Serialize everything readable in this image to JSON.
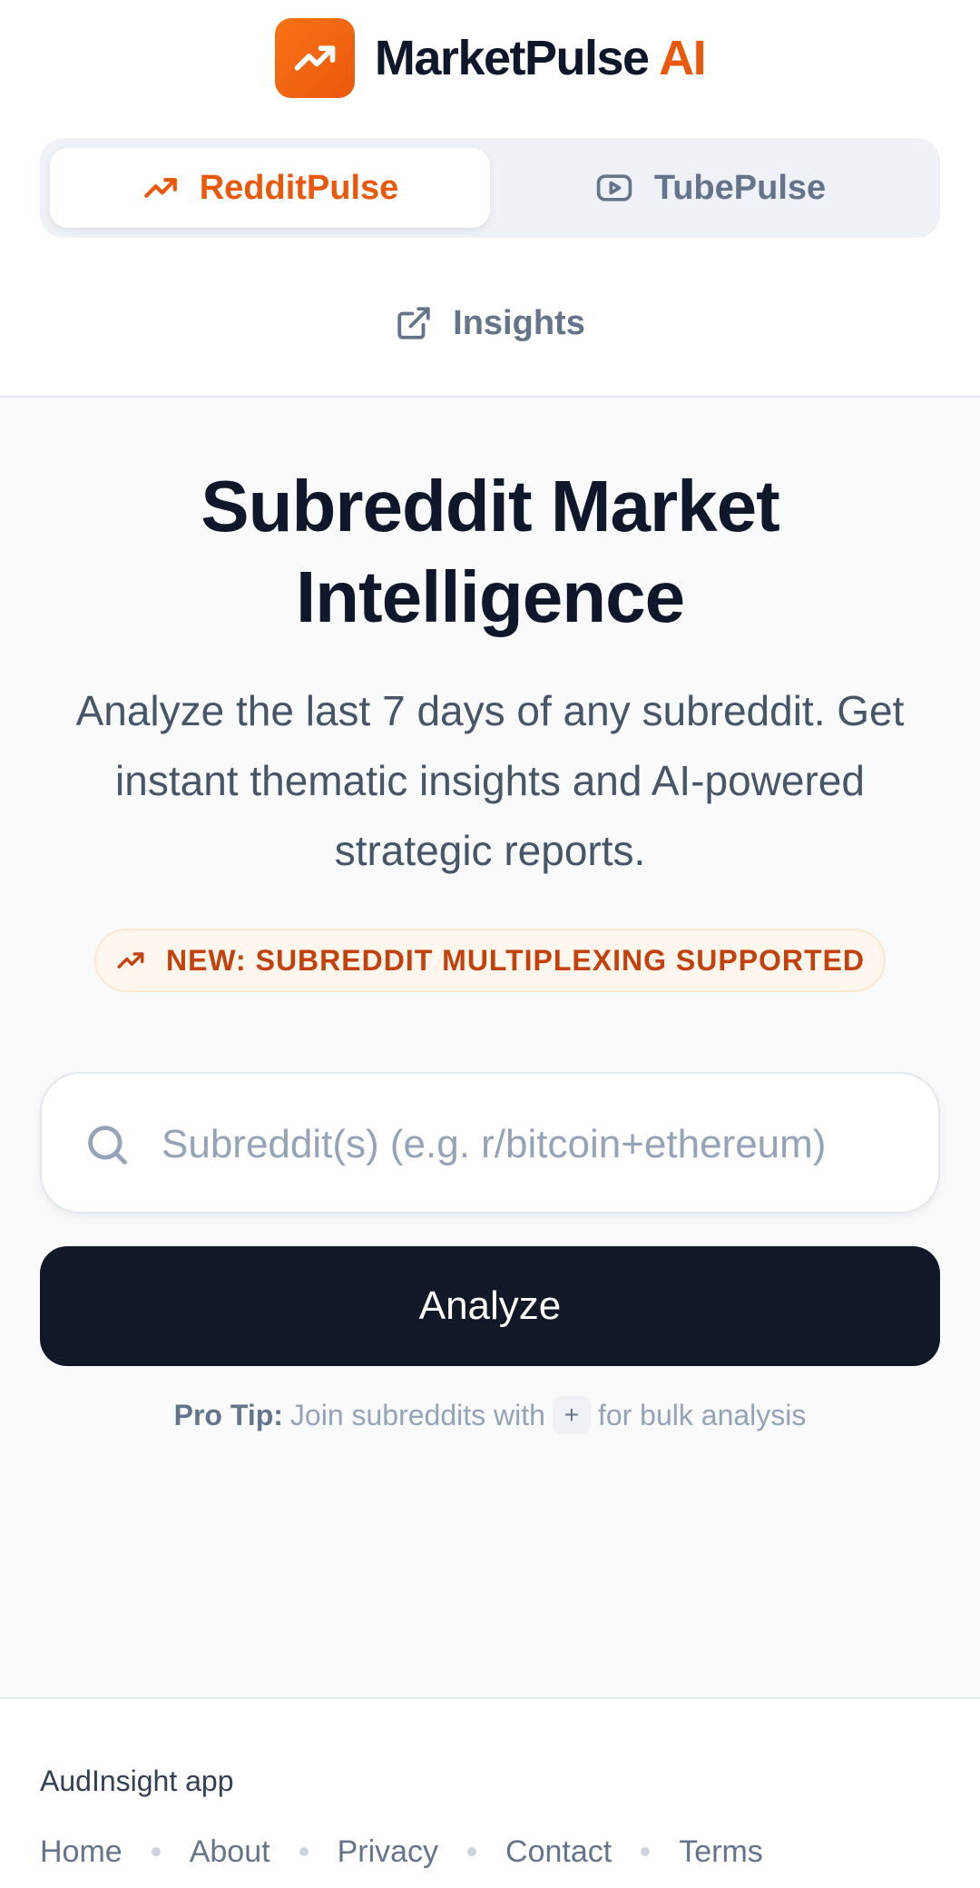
{
  "brand": {
    "name_main": "MarketPulse",
    "name_accent": "AI",
    "logo_icon": "trending-up-icon",
    "accent_color": "#ea580c"
  },
  "switcher": {
    "tabs": [
      {
        "label": "RedditPulse",
        "icon": "trending-up-icon",
        "active": true
      },
      {
        "label": "TubePulse",
        "icon": "youtube-play-icon",
        "active": false
      }
    ]
  },
  "insights_link": {
    "label": "Insights",
    "icon": "external-link-icon"
  },
  "main": {
    "title": "Subreddit Market Intelligence",
    "subtitle": "Analyze the last 7 days of any subreddit. Get instant thematic insights and AI-powered strategic reports.",
    "badge": "NEW: SUBREDDIT MULTIPLEXING SUPPORTED",
    "search": {
      "placeholder": "Subreddit(s) (e.g. r/bitcoin+ethereum)",
      "value": ""
    },
    "analyze_label": "Analyze",
    "pro_tip": {
      "label": "Pro Tip:",
      "text_before": "Join subreddits with",
      "key": "+",
      "text_after": "for bulk analysis"
    }
  },
  "footer": {
    "brand": "AudInsight app",
    "links": [
      "Home",
      "About",
      "Privacy",
      "Contact",
      "Terms"
    ]
  },
  "colors": {
    "primary_dark": "#111827",
    "background": "#f8fafc",
    "muted": "#64748b"
  }
}
